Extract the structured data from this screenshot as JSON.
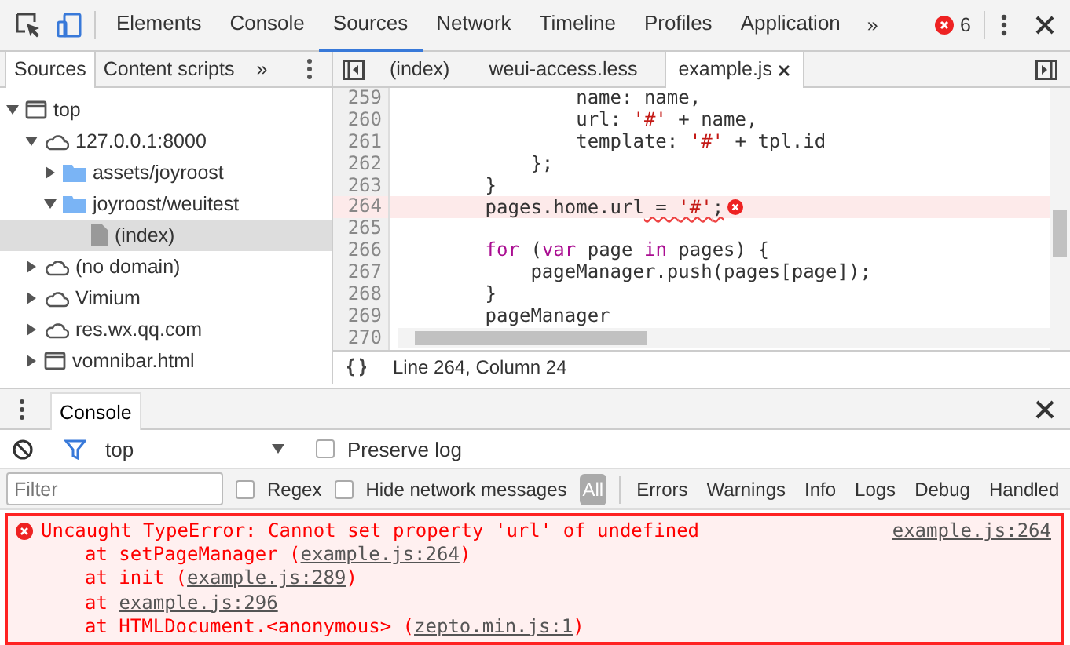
{
  "toolbar": {
    "tabs": [
      {
        "label": "Elements",
        "selected": false
      },
      {
        "label": "Console",
        "selected": false
      },
      {
        "label": "Sources",
        "selected": true
      },
      {
        "label": "Network",
        "selected": false
      },
      {
        "label": "Timeline",
        "selected": false
      },
      {
        "label": "Profiles",
        "selected": false
      },
      {
        "label": "Application",
        "selected": false
      }
    ],
    "more": "»",
    "error_count": "6"
  },
  "navigator": {
    "tabs": [
      {
        "label": "Sources",
        "selected": true
      },
      {
        "label": "Content scripts",
        "selected": false
      }
    ],
    "more": "»",
    "tree": [
      {
        "label": "top",
        "kind": "frame",
        "expanded": true,
        "selected": false,
        "children": [
          {
            "label": "127.0.0.1:8000",
            "kind": "domain",
            "expanded": true,
            "selected": false,
            "children": [
              {
                "label": "assets/joyroost",
                "kind": "folder",
                "expanded": false,
                "selected": false
              },
              {
                "label": "joyroost/weuitest",
                "kind": "folder",
                "expanded": true,
                "selected": false,
                "children": [
                  {
                    "label": "(index)",
                    "kind": "file",
                    "selected": true
                  }
                ]
              }
            ]
          },
          {
            "label": "(no domain)",
            "kind": "domain",
            "expanded": false,
            "selected": false
          },
          {
            "label": "Vimium",
            "kind": "domain",
            "expanded": false,
            "selected": false
          },
          {
            "label": "res.wx.qq.com",
            "kind": "domain",
            "expanded": false,
            "selected": false
          },
          {
            "label": "vomnibar.html",
            "kind": "frame",
            "expanded": false,
            "selected": false
          }
        ]
      }
    ]
  },
  "editor": {
    "tabs": [
      {
        "label": "(index)",
        "selected": false
      },
      {
        "label": "weui-access.less",
        "selected": false
      },
      {
        "label": "example.js",
        "selected": true
      }
    ],
    "lines": [
      {
        "number": "259",
        "highlighted": false,
        "segments": [
          {
            "text": "                name: name,",
            "kind": "plain"
          }
        ]
      },
      {
        "number": "260",
        "highlighted": false,
        "segments": [
          {
            "text": "                url: ",
            "kind": "plain"
          },
          {
            "text": "'#'",
            "kind": "string"
          },
          {
            "text": " + name,",
            "kind": "plain"
          }
        ]
      },
      {
        "number": "261",
        "highlighted": false,
        "segments": [
          {
            "text": "                template: ",
            "kind": "plain"
          },
          {
            "text": "'#'",
            "kind": "string"
          },
          {
            "text": " + tpl.id",
            "kind": "plain"
          }
        ]
      },
      {
        "number": "262",
        "highlighted": false,
        "segments": [
          {
            "text": "            };",
            "kind": "plain"
          }
        ]
      },
      {
        "number": "263",
        "highlighted": false,
        "segments": [
          {
            "text": "        }",
            "kind": "plain"
          }
        ]
      },
      {
        "number": "264",
        "highlighted": true,
        "segments": [
          {
            "text": "        pages.home.url",
            "kind": "plain"
          },
          {
            "text": " = ",
            "kind": "plain",
            "squiggle": true
          },
          {
            "text": "'#'",
            "kind": "string",
            "squiggle": true
          },
          {
            "text": ";",
            "kind": "plain",
            "squiggle": true
          }
        ]
      },
      {
        "number": "265",
        "highlighted": false
      },
      {
        "number": "266",
        "highlighted": false,
        "segments": [
          {
            "text": "        for",
            "kind": "keyword"
          },
          {
            "text": " (",
            "kind": "plain"
          },
          {
            "text": "var",
            "kind": "keyword"
          },
          {
            "text": " page ",
            "kind": "plain"
          },
          {
            "text": "in",
            "kind": "keyword"
          },
          {
            "text": " pages) {",
            "kind": "plain"
          }
        ]
      },
      {
        "number": "267",
        "highlighted": false,
        "segments": [
          {
            "text": "            pageManager.push(pages[page]);",
            "kind": "plain"
          }
        ]
      },
      {
        "number": "268",
        "highlighted": false,
        "segments": [
          {
            "text": "        }",
            "kind": "plain"
          }
        ]
      },
      {
        "number": "269",
        "highlighted": false,
        "segments": [
          {
            "text": "        pageManager",
            "kind": "plain"
          }
        ]
      },
      {
        "number": "270",
        "highlighted": false
      }
    ],
    "status": "Line 264, Column 24"
  },
  "drawer": {
    "tabs": [
      {
        "label": "Console",
        "selected": true
      }
    ]
  },
  "console": {
    "context": "top",
    "preserve_log": {
      "label": "Preserve log",
      "checked": false
    },
    "filter": {
      "placeholder": "Filter"
    },
    "regex": {
      "label": "Regex",
      "checked": false
    },
    "hide_network": {
      "label": "Hide network messages",
      "checked": false
    },
    "levels": [
      {
        "label": "All",
        "selected": true
      },
      {
        "label": "Errors",
        "selected": false
      },
      {
        "label": "Warnings",
        "selected": false
      },
      {
        "label": "Info",
        "selected": false
      },
      {
        "label": "Logs",
        "selected": false
      },
      {
        "label": "Debug",
        "selected": false
      },
      {
        "label": "Handled",
        "selected": false
      }
    ],
    "messages": [
      {
        "kind": "error",
        "text": "Uncaught TypeError: Cannot set property 'url' of undefined",
        "source": "example.js:264",
        "stack": [
          {
            "before": "at setPageManager (",
            "link": "example.js:264",
            "after": ")"
          },
          {
            "before": "at init (",
            "link": "example.js:289",
            "after": ")"
          },
          {
            "before": "at ",
            "link": "example.js:296"
          },
          {
            "before": "at HTMLDocument.<anonymous> (",
            "link": "zepto.min.js:1",
            "after": ")"
          }
        ]
      }
    ]
  }
}
